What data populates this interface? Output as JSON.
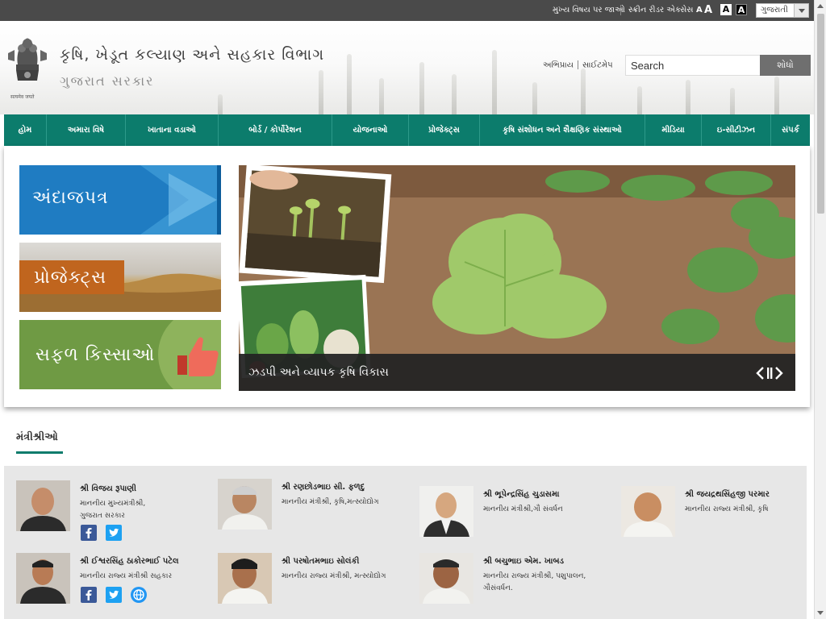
{
  "topbar": {
    "skip_link": "મુખ્ય વિષય પર જાઓ",
    "screen_reader": "સ્ક્રીન રીડર એક્સેસ",
    "font_small": "A",
    "font_large": "A",
    "contrast_light": "A",
    "contrast_dark": "A",
    "language": "ગુજરાતી"
  },
  "header": {
    "emblem_motto": "सत्यमेव जयते",
    "department": "કૃષિ, ખેડૂત કલ્યાણ અને સહકાર વિભાગ",
    "government": "ગુજરાત સરકાર",
    "link_feedback": "અભિપ્રાય",
    "link_sitemap": "સાઈટમેપ",
    "search_placeholder": "Search",
    "search_button": "શોધો"
  },
  "nav": {
    "items": [
      {
        "label": "હોમ"
      },
      {
        "label": "અમારા વિષે"
      },
      {
        "label": "ખાતાના વડાઓ"
      },
      {
        "label": "બોર્ડ / કોર્પોરેશન"
      },
      {
        "label": "યોજનાઓ"
      },
      {
        "label": "પ્રોજેક્ટ્સ"
      },
      {
        "label": "કૃષિ સંશોધન અને શૈક્ષણિક સંસ્થાઓ"
      },
      {
        "label": "મીડિયા"
      },
      {
        "label": "ઇ-સીટીઝન"
      },
      {
        "label": "સંપર્ક"
      }
    ]
  },
  "banner": {
    "tile_budget": "અંદાજપત્ર",
    "tile_projects": "પ્રોજેક્ટ્સ",
    "tile_success": "સફળ કિસ્સાઓ",
    "slide_caption": "ઝડપી અને વ્યાપક કૃષિ વિકાસ"
  },
  "ministers": {
    "heading": "મંત્રીશ્રીઓ",
    "list": [
      {
        "name": "શ્રી વિજય રૂપાણી",
        "designation": "માનનીય મુખ્યમંત્રીશ્રી,",
        "designation2": "ગુજરાત સરકાર"
      },
      {
        "name": "શ્રી રણછોડભાઇ સી. ફળદુ",
        "designation": "માનનીય મંત્રીશ્રી, કૃષિ,મત્સ્યોદ્યોગ",
        "designation2": ""
      },
      {
        "name": "શ્રી ભૂપેન્દ્રસિંહ ચુડાસમા",
        "designation": "માનનીય મંત્રીશ્રી,ગૌ સંવર્ધન",
        "designation2": ""
      },
      {
        "name": "શ્રી જયદ્રથસિંહજી પરમાર",
        "designation": "માનનીય રાજ્ય મંત્રીશ્રી, કૃષિ",
        "designation2": ""
      },
      {
        "name": "શ્રી ઈશ્વરસિંહ ઠાકોરભાઈ પટેલ",
        "designation": "માનનીય રાજ્ય મંત્રીશ્રી સહકાર",
        "designation2": ""
      },
      {
        "name": "શ્રી પરષોતમભાઇ સોલંકી",
        "designation": "માનનીય રાજ્ય મંત્રીશ્રી, મત્સ્યોદ્યોગ",
        "designation2": ""
      },
      {
        "name": "શ્રી બચુભાઇ એમ. ખાબડ",
        "designation": "માનનીય રાજ્ય મંત્રીશ્રી, પશુપાલન,",
        "designation2": "ગૌસંવર્ધન."
      }
    ]
  },
  "colors": {
    "nav_green": "#0c7c6c",
    "topbar_gray": "#4a4a4a",
    "tile_blue": "#1f7cc2",
    "tile_green": "#6f9a44",
    "tile_orange": "#c0651e"
  }
}
